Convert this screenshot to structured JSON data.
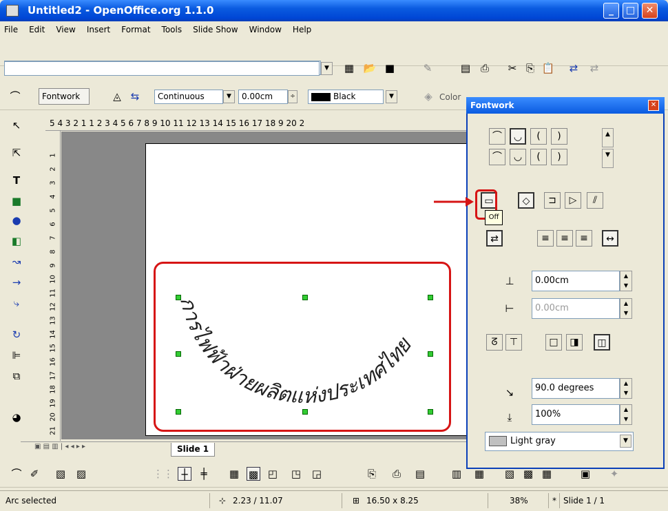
{
  "window": {
    "title": "Untitled2 - OpenOffice.org 1.1.0"
  },
  "menu": [
    "File",
    "Edit",
    "View",
    "Insert",
    "Format",
    "Tools",
    "Slide Show",
    "Window",
    "Help"
  ],
  "lineprops": {
    "fontwork_label": "Fontwork",
    "line_style": "Continuous",
    "line_width": "0.00cm",
    "line_color": "Black",
    "area_label": "Color"
  },
  "ruler_top": "5 4 3 2 1   1 2 3 4 5 6 7 8 9 10 11 12 13 14 15 16 17 18 9 20 2",
  "ruler_left": [
    "1",
    "2",
    "3",
    "4",
    "5",
    "6",
    "7",
    "8",
    "9",
    "10",
    "11",
    "12",
    "13",
    "14",
    "15",
    "16",
    "17",
    "18",
    "19",
    "20",
    "21"
  ],
  "slide": {
    "text": "การไฟฟ้าฝ่ายผลิตแห่งประเทศไทย"
  },
  "tabs": {
    "slide_tab": "Slide 1"
  },
  "fontwork": {
    "title": "Fontwork",
    "tooltip": "Off",
    "distance": "0.00cm",
    "indent": "0.00cm",
    "angle": "90.0 degrees",
    "size": "100%",
    "shadow_color": "Light gray"
  },
  "status": {
    "selection": "Arc selected",
    "position": "2.23 / 11.07",
    "size": "16.50 x 8.25",
    "zoom": "38%",
    "star": "*",
    "page": "Slide 1 / 1"
  },
  "colors": {
    "accent": "#0a5be0",
    "highlight": "#d61515",
    "handle": "#33cc33"
  }
}
